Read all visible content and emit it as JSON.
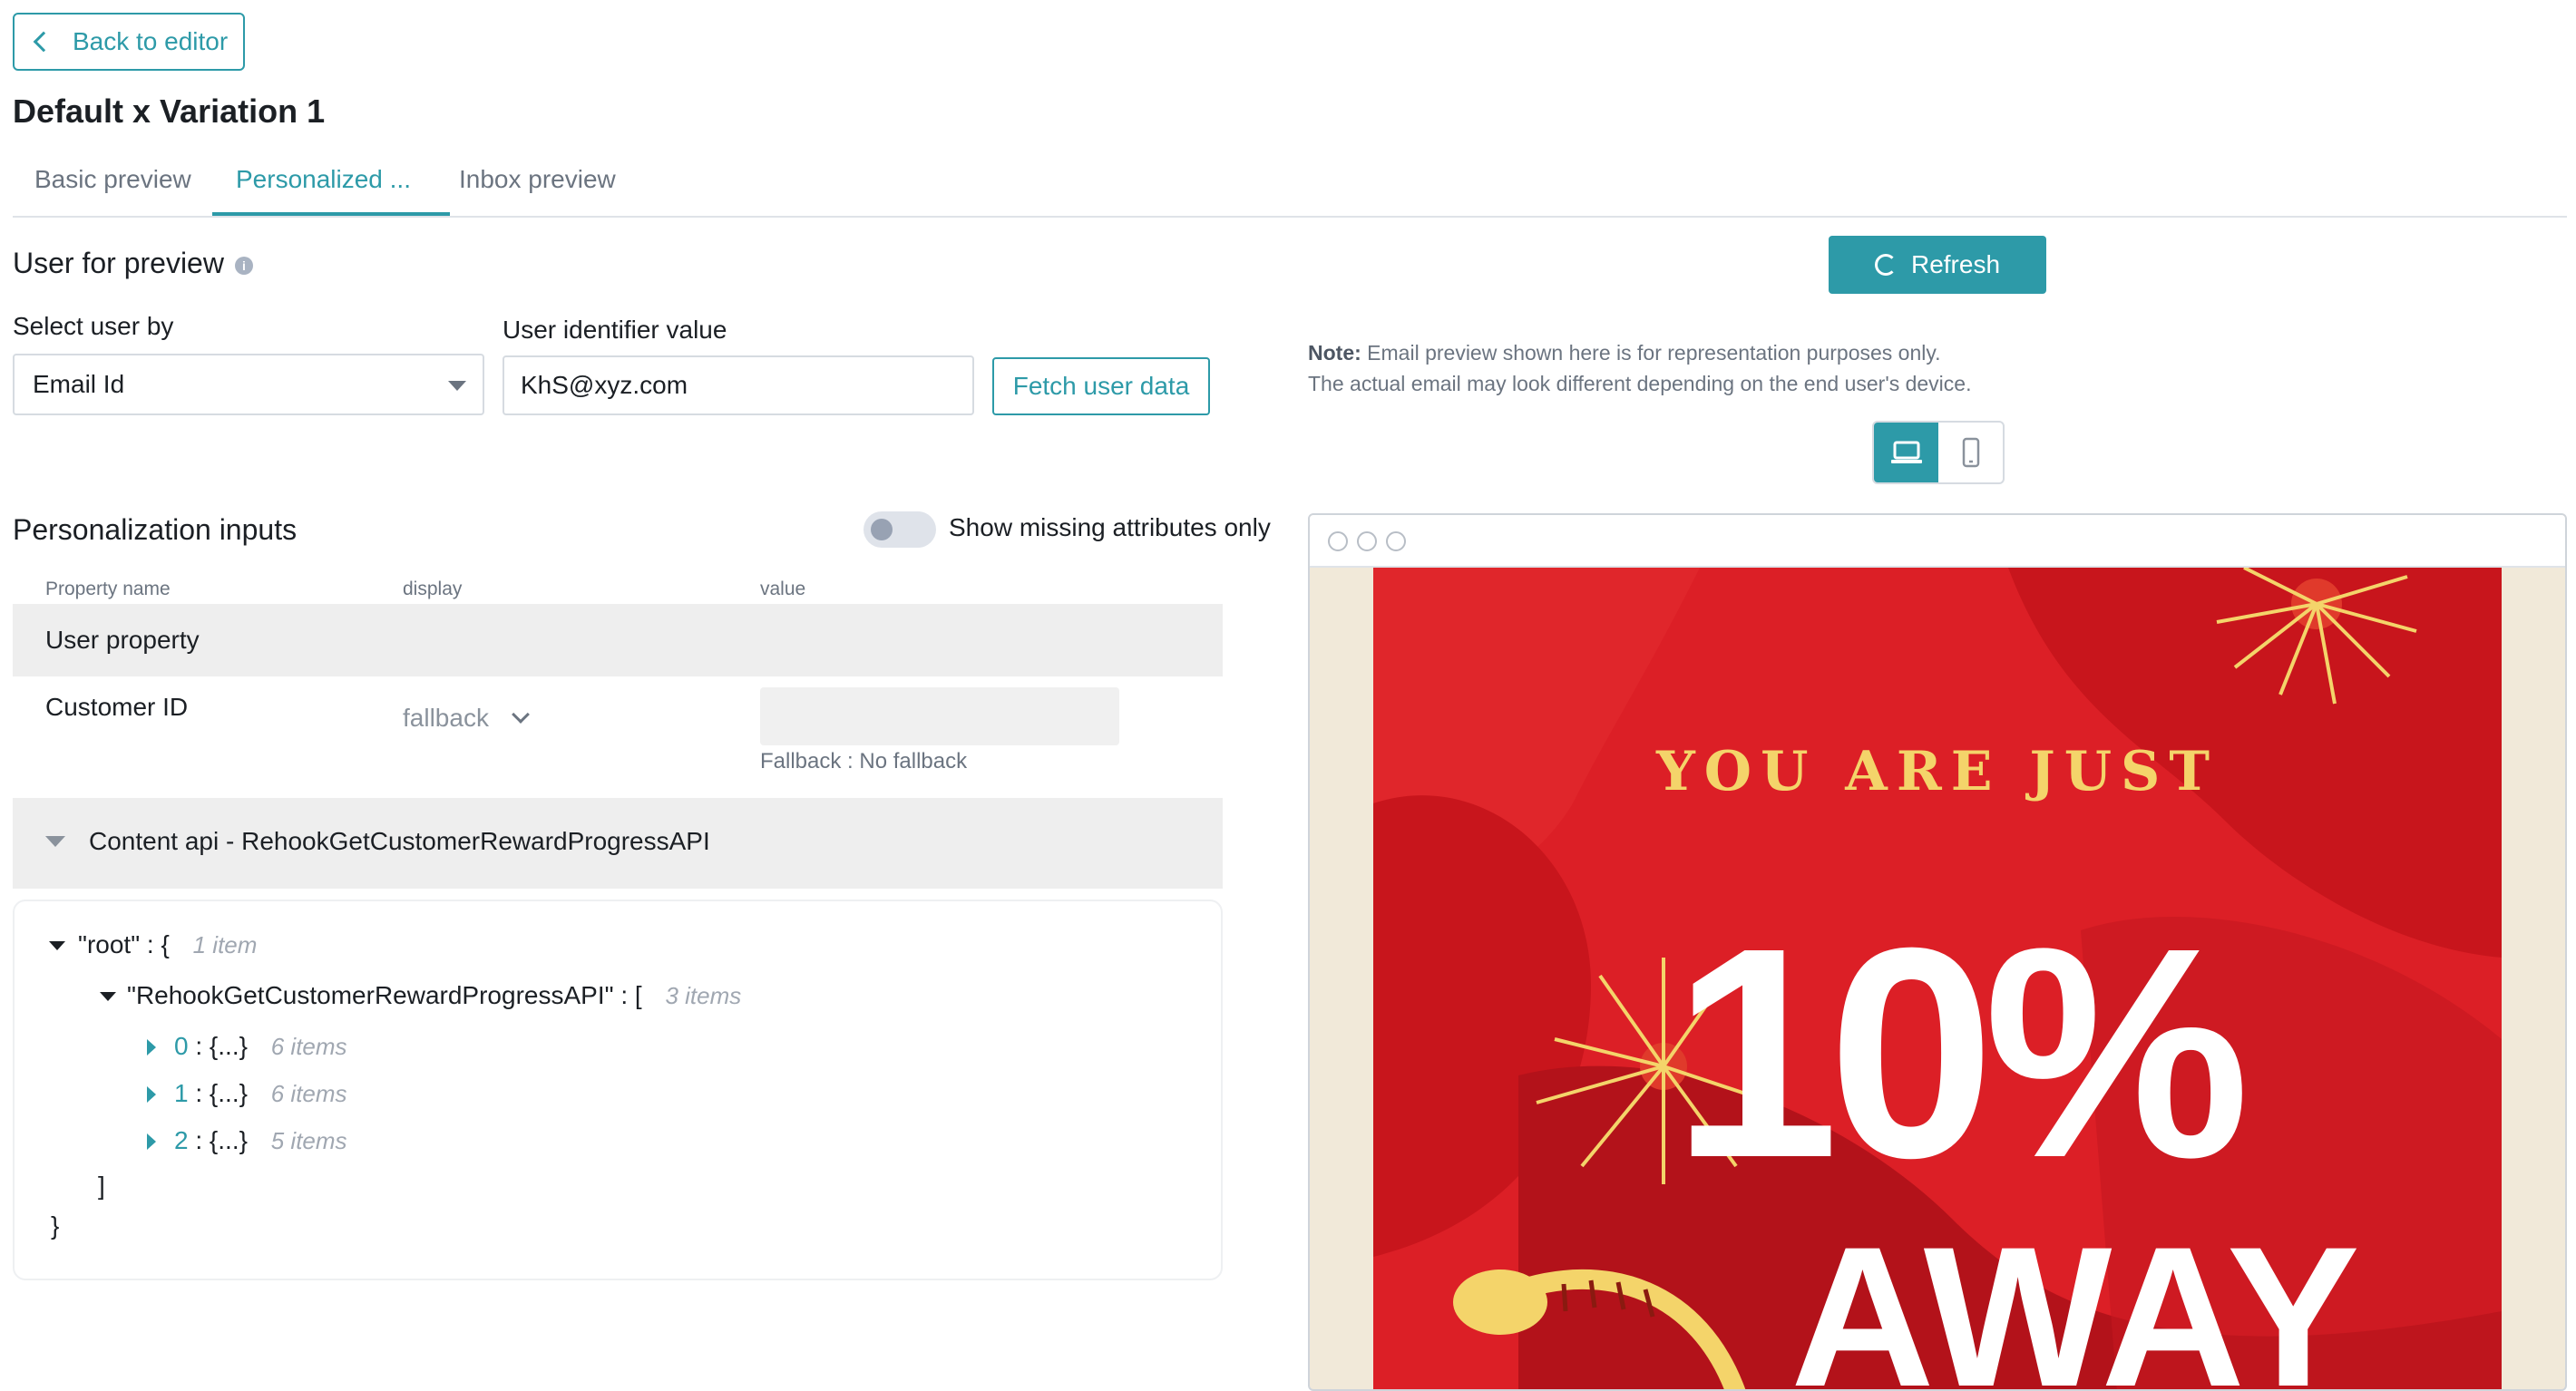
{
  "header": {
    "back_label": "Back to editor",
    "page_title": "Default x Variation 1"
  },
  "tabs": [
    {
      "label": "Basic preview",
      "active": false
    },
    {
      "label": "Personalized ...",
      "active": true
    },
    {
      "label": "Inbox preview",
      "active": false
    }
  ],
  "user_preview": {
    "title": "User for preview",
    "info_icon": "info-icon",
    "select_label": "Select user by",
    "select_value": "Email Id",
    "identifier_label": "User identifier value",
    "identifier_value": "KhS@xyz.com",
    "fetch_label": "Fetch user data"
  },
  "personalization": {
    "title": "Personalization inputs",
    "toggle_label": "Show missing attributes only",
    "toggle_on": false,
    "columns": [
      "Property name",
      "display",
      "value"
    ],
    "group_label": "User property",
    "row": {
      "name": "Customer ID",
      "display": "fallback",
      "value": "",
      "fallback_note": "Fallback : No fallback"
    },
    "api_label": "Content api - RehookGetCustomerRewardProgressAPI"
  },
  "json_tree": {
    "root_key": "\"root\"",
    "root_open": ": {",
    "root_meta": "1 item",
    "api_key": "\"RehookGetCustomerRewardProgressAPI\"",
    "api_open": ": [",
    "api_meta": "3 items",
    "children": [
      {
        "index": "0",
        "sep": ":",
        "obj": "{...}",
        "meta": "6 items"
      },
      {
        "index": "1",
        "sep": ":",
        "obj": "{...}",
        "meta": "6 items"
      },
      {
        "index": "2",
        "sep": ":",
        "obj": "{...}",
        "meta": "5 items"
      }
    ],
    "api_close": "]",
    "root_close": "}"
  },
  "preview": {
    "refresh_label": "Refresh",
    "note_bold": "Note:",
    "note_line1": " Email preview shown here is for representation purposes only.",
    "note_line2": "The actual email may look different depending on the end user's device.",
    "device_desktop": "laptop-icon",
    "device_mobile": "mobile-icon",
    "email_heading": "YOU ARE JUST",
    "email_big": "10%",
    "email_away": "AWAY"
  },
  "colors": {
    "accent": "#2d9aa8",
    "email_red": "#dc1f26",
    "email_gold": "#f4d46a"
  }
}
